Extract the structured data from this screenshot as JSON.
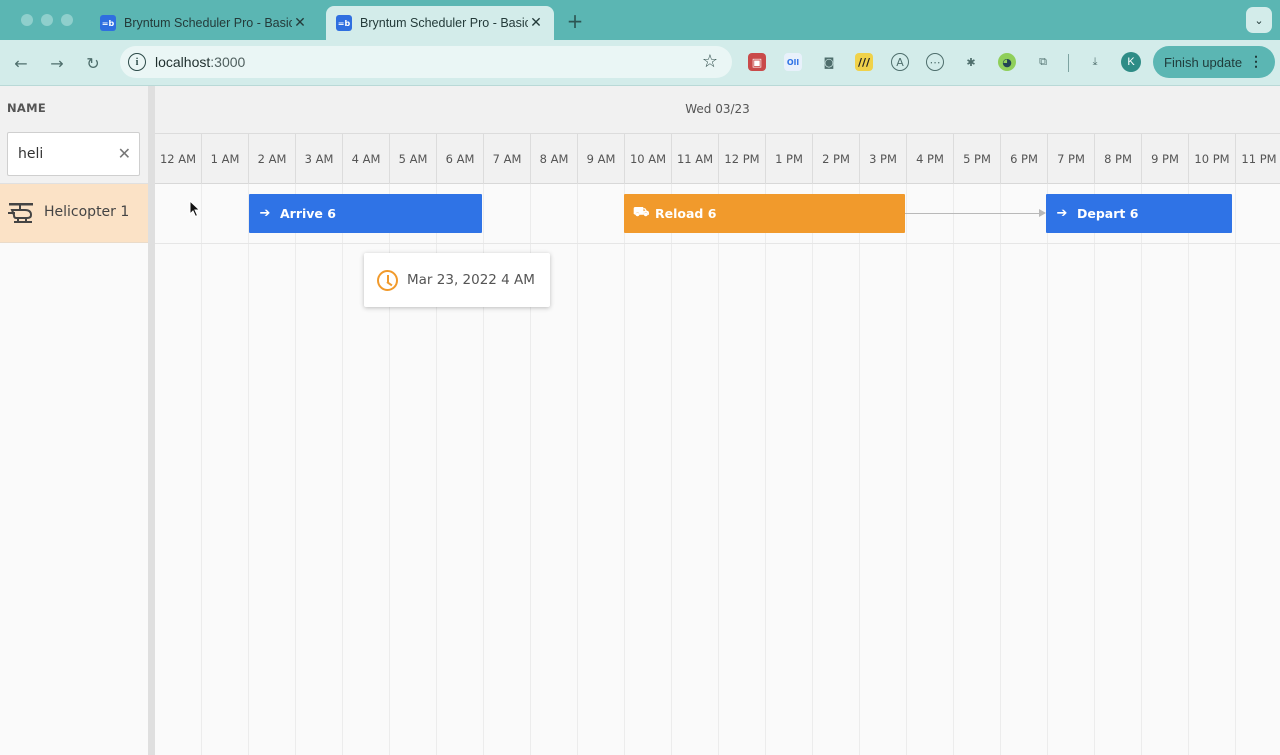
{
  "browser": {
    "tabs": [
      {
        "title": "Bryntum Scheduler Pro - Basic",
        "favicon": "bryntum-favicon",
        "active": false
      },
      {
        "title": "Bryntum Scheduler Pro - Basic",
        "favicon": "bryntum-favicon",
        "active": true
      }
    ],
    "new_tab": "+",
    "address": {
      "host": "localhost",
      "port": ":3000"
    },
    "profile_initial": "K",
    "update_button": "Finish update",
    "colors": {
      "chrome": "#5bb6b3",
      "toolbar": "#d3ecea"
    }
  },
  "scheduler": {
    "name_column_header": "NAME",
    "filter_value": "heli",
    "day_label": "Wed 03/23",
    "hours": [
      "12 AM",
      "1 AM",
      "2 AM",
      "3 AM",
      "4 AM",
      "5 AM",
      "6 AM",
      "7 AM",
      "8 AM",
      "9 AM",
      "10 AM",
      "11 AM",
      "12 PM",
      "1 PM",
      "2 PM",
      "3 PM",
      "4 PM",
      "5 PM",
      "6 PM",
      "7 PM",
      "8 PM",
      "9 PM",
      "10 PM",
      "11 PM"
    ],
    "resources": [
      {
        "name": "Helicopter 1",
        "icon": "helicopter-icon"
      }
    ],
    "events": [
      {
        "name": "Arrive 6",
        "icon": "arrow-right-icon",
        "color": "#2f73e6"
      },
      {
        "name": "Reload 6",
        "icon": "truck-loading-icon",
        "color": "#f19a2c"
      },
      {
        "name": "Depart 6",
        "icon": "arrow-right-icon",
        "color": "#2f73e6"
      }
    ],
    "tooltip": {
      "text": "Mar 23, 2022 4 AM",
      "icon": "clock-icon"
    }
  }
}
